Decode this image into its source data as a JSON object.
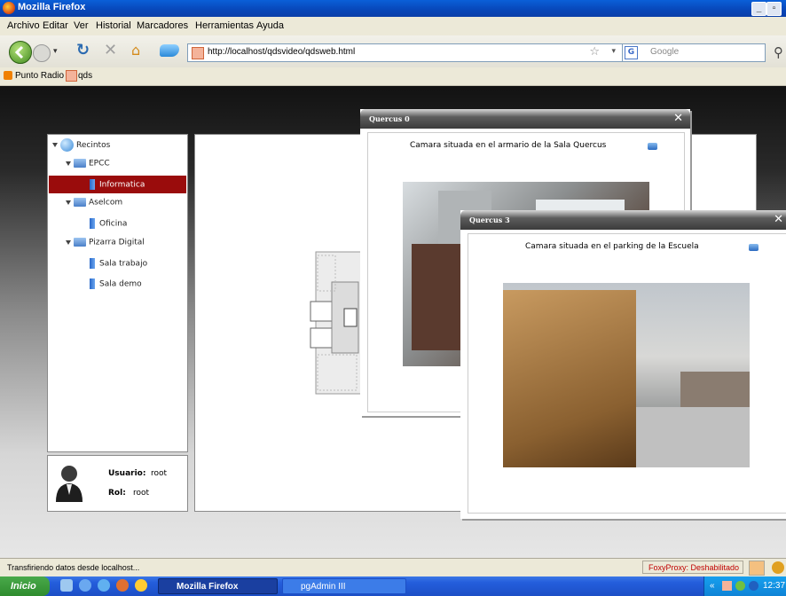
{
  "window": {
    "title": "Mozilla Firefox"
  },
  "menu": [
    "Archivo",
    "Editar",
    "Ver",
    "Historial",
    "Marcadores",
    "Herramientas",
    "Ayuda"
  ],
  "address": {
    "url": "http://localhost/qdsvideo/qdsweb.html",
    "search_placeholder": "Google"
  },
  "bookmarks": [
    "Punto Radio",
    "qds"
  ],
  "tree": {
    "root": "Recintos",
    "items": [
      {
        "label": "EPCC"
      },
      {
        "label": "Informatica",
        "selected": true
      },
      {
        "label": "Aselcom"
      },
      {
        "label": "Oficina"
      },
      {
        "label": "Pizarra Digital"
      },
      {
        "label": "Sala trabajo"
      },
      {
        "label": "Sala demo"
      }
    ]
  },
  "user": {
    "user_label": "Usuario:",
    "user_value": "root",
    "role_label": "Rol:",
    "role_value": "root"
  },
  "popups": [
    {
      "title": "Quercus 0",
      "caption": "Camara situada en el armario de la Sala Quercus"
    },
    {
      "title": "Quercus 3",
      "caption": "Camara situada en el parking de la Escuela"
    }
  ],
  "status": {
    "text": "Transfiriendo datos desde localhost...",
    "foxy": "FoxyProxy: Deshabilitado"
  },
  "taskbar": {
    "start": "Inicio",
    "tasks": [
      "Mozilla Firefox",
      "pgAdmin III"
    ],
    "clock": "12:37"
  },
  "colors": {
    "selected": "#9a0c0c",
    "titlebar": "#0846b8"
  }
}
